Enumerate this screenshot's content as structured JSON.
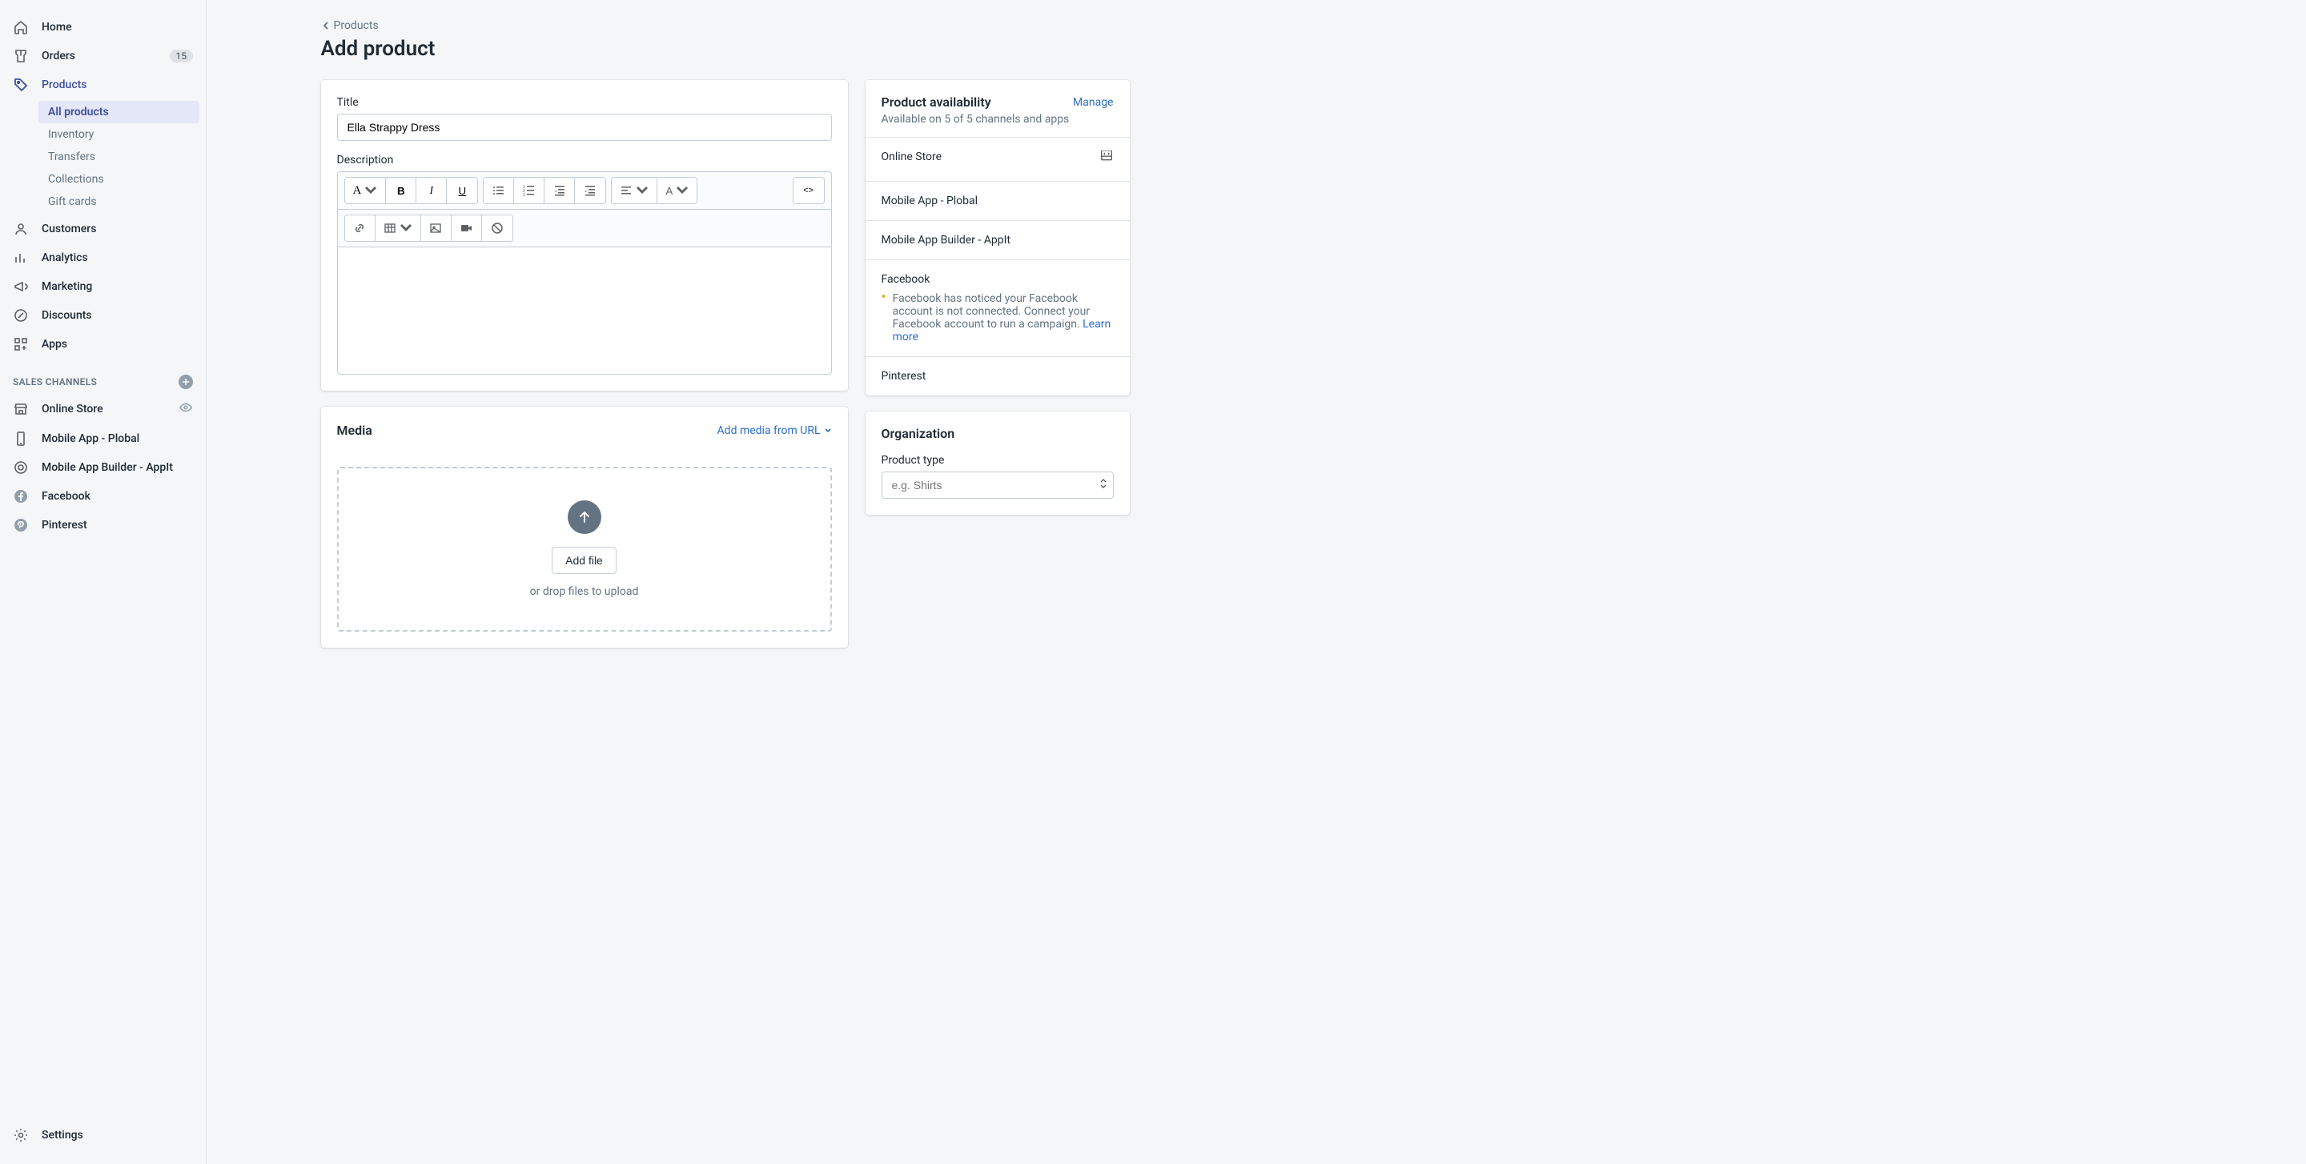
{
  "sidebar": {
    "nav": [
      {
        "label": "Home",
        "icon": "home"
      },
      {
        "label": "Orders",
        "icon": "orders",
        "badge": "15"
      },
      {
        "label": "Products",
        "icon": "products",
        "active": true
      },
      {
        "label": "Customers",
        "icon": "customers"
      },
      {
        "label": "Analytics",
        "icon": "analytics"
      },
      {
        "label": "Marketing",
        "icon": "marketing"
      },
      {
        "label": "Discounts",
        "icon": "discounts"
      },
      {
        "label": "Apps",
        "icon": "apps"
      }
    ],
    "products_sub": [
      {
        "label": "All products",
        "active": true
      },
      {
        "label": "Inventory"
      },
      {
        "label": "Transfers"
      },
      {
        "label": "Collections"
      },
      {
        "label": "Gift cards"
      }
    ],
    "channels_header": "SALES CHANNELS",
    "channels": [
      {
        "label": "Online Store",
        "icon": "store",
        "eye": true
      },
      {
        "label": "Mobile App - Plobal",
        "icon": "mobile"
      },
      {
        "label": "Mobile App Builder - AppIt",
        "icon": "target"
      },
      {
        "label": "Facebook",
        "icon": "facebook"
      },
      {
        "label": "Pinterest",
        "icon": "pinterest"
      }
    ],
    "settings": "Settings"
  },
  "breadcrumb": "Products",
  "page_title": "Add product",
  "form": {
    "title_label": "Title",
    "title_value": "Ella Strappy Dress",
    "description_label": "Description"
  },
  "media": {
    "title": "Media",
    "add_url": "Add media from URL",
    "add_file_btn": "Add file",
    "drop_hint": "or drop files to upload"
  },
  "availability": {
    "title": "Product availability",
    "manage": "Manage",
    "subtitle": "Available on 5 of 5 channels and apps",
    "channels": [
      {
        "name": "Online Store",
        "calendar": true
      },
      {
        "name": "Mobile App - Plobal"
      },
      {
        "name": "Mobile App Builder - AppIt"
      },
      {
        "name": "Facebook",
        "warning": "Facebook has noticed your Facebook account is not connected. Connect your Facebook account to run a campaign.",
        "learn_more": "Learn more"
      },
      {
        "name": "Pinterest"
      }
    ]
  },
  "organization": {
    "title": "Organization",
    "product_type_label": "Product type",
    "product_type_placeholder": "e.g. Shirts"
  }
}
